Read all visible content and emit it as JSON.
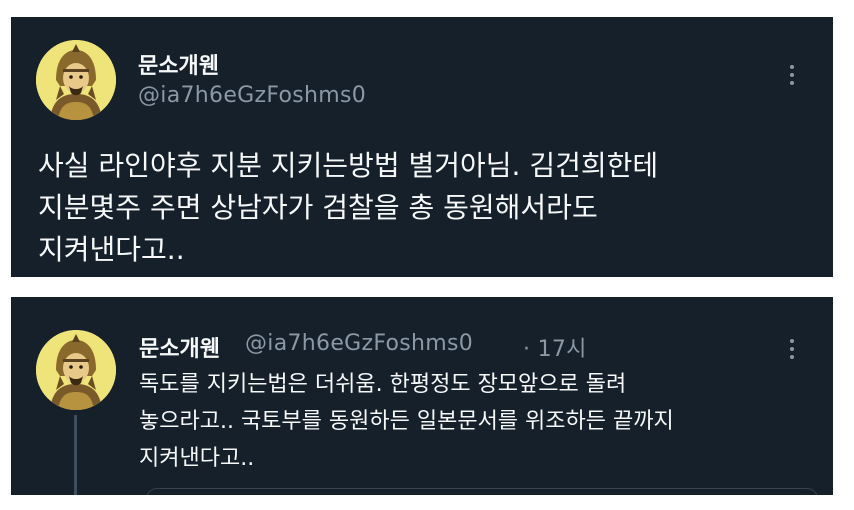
{
  "tweets": [
    {
      "display_name": "문소개웬",
      "handle": "@ia7h6eGzFoshms0",
      "text": "사실 라인야후 지분 지키는방법 별거아님. 김건희한테\n지분몇주 주면 상남자가 검찰을 총 동원해서라도\n지켜낸다고..",
      "more_icon": "more-vertical-icon",
      "avatar_icon": "warrior-portrait-icon"
    },
    {
      "display_name": "문소개웬",
      "handle": "@ia7h6eGzFoshms0",
      "time": "· 17시",
      "text": "독도를 지키는법은 더쉬움. 한평정도 장모앞으로 돌려\n놓으라고.. 국토부를 동원하든 일본문서를 위조하든 끝까지\n지켜낸다고..",
      "more_icon": "more-vertical-icon",
      "avatar_icon": "warrior-portrait-icon"
    }
  ],
  "theme": {
    "card_background": "#15202b",
    "primary_text": "#f7f9f9",
    "secondary_text": "#8b98a5",
    "avatar_background": "#efe47a"
  }
}
